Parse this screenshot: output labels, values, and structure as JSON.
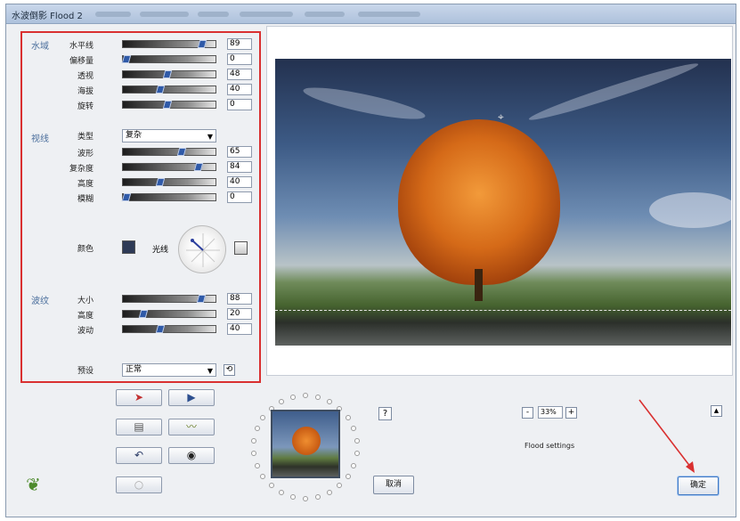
{
  "window": {
    "title": "水波倒影 Flood 2"
  },
  "panel": {
    "water": {
      "section_label": "水域",
      "rows": [
        {
          "label": "水平线",
          "value": "89",
          "level": 0.89
        },
        {
          "label": "偏移量",
          "value": "0",
          "level": 0.0
        },
        {
          "label": "透视",
          "value": "48",
          "level": 0.48
        },
        {
          "label": "海拔",
          "value": "40",
          "level": 0.4
        },
        {
          "label": "旋转",
          "value": "0",
          "level": 0.48
        }
      ]
    },
    "waves": {
      "section_label": "视线",
      "type_label": "类型",
      "type_value": "复杂",
      "rows": [
        {
          "label": "波形",
          "value": "65",
          "level": 0.65
        },
        {
          "label": "复杂度",
          "value": "84",
          "level": 0.84
        },
        {
          "label": "高度",
          "value": "40",
          "level": 0.4
        },
        {
          "label": "模糊",
          "value": "0",
          "level": 0.0
        }
      ],
      "color_label": "颜色",
      "light_label": "光线"
    },
    "ripples": {
      "section_label": "波纹",
      "rows": [
        {
          "label": "大小",
          "value": "88",
          "level": 0.88
        },
        {
          "label": "高度",
          "value": "20",
          "level": 0.2
        },
        {
          "label": "波动",
          "value": "40",
          "level": 0.4
        }
      ]
    },
    "preset": {
      "label": "预设",
      "value": "正常"
    }
  },
  "tool_buttons": [
    "random-arrow-icon",
    "play-icon",
    "paste-icon",
    "wave-icon",
    "undo-icon",
    "ring-icon",
    "blank-icon"
  ],
  "help_button": "?",
  "zoom": {
    "minus": "-",
    "value": "33%",
    "plus": "+"
  },
  "status_text": "Flood settings",
  "cancel_button": "取消",
  "ok_button": "确定",
  "colors": {
    "highlight_border": "#d93030",
    "annotation_arrow": "#d93030",
    "swatch_color": "#2e3a56"
  }
}
